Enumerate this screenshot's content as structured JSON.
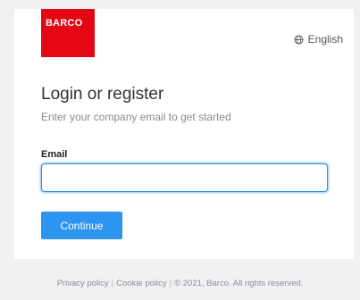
{
  "brand": {
    "logo_text": "BARCO",
    "logo_color": "#e30613"
  },
  "language": {
    "icon": "globe-icon",
    "label": "English"
  },
  "form": {
    "title": "Login or register",
    "subtitle": "Enter your company email to get started",
    "email_label": "Email",
    "email_value": "",
    "email_placeholder": "",
    "continue_label": "Continue",
    "accent_color": "#2d94ef"
  },
  "footer": {
    "privacy": "Privacy policy",
    "cookie": "Cookie policy",
    "separator": "|",
    "copyright": "© 2021, Barco. All rights reserved."
  }
}
